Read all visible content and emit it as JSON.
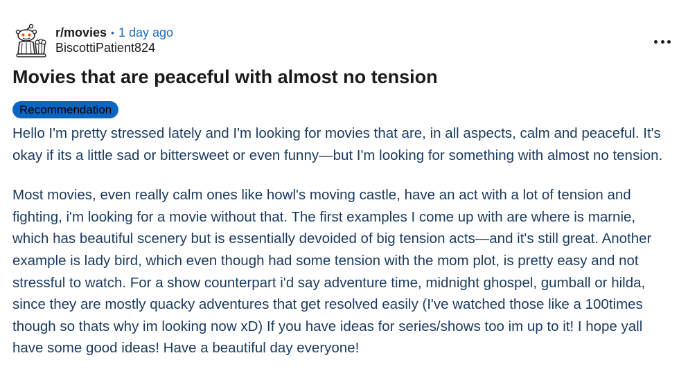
{
  "post": {
    "subreddit": "r/movies",
    "separator": "•",
    "time_ago": "1 day ago",
    "username": "BiscottiPatient824",
    "title": "Movies that are peaceful with almost no tension",
    "flair": "Recommendation",
    "paragraphs": [
      "Hello I'm pretty stressed lately and I'm looking for movies that are, in all aspects, calm and peaceful. It's okay if its a little sad or bittersweet or even funny—but I'm looking for something with almost no tension.",
      "Most movies, even really calm ones like howl's moving castle, have an act with a lot of tension and fighting, i'm looking for a movie without that. The first examples I come up with are where is marnie, which has beautiful scenery but is essentially devoided of big tension acts—and it's still great. Another example is lady bird, which even though had some tension with the mom plot, is pretty easy and not stressful to watch. For a show counterpart i'd say adventure time, midnight ghospel, gumball or hilda, since they are mostly quacky adventures that get resolved easily (I've watched those like a 100times though so thats why im looking now xD) If you have ideas for series/shows too im up to it! I hope yall have some good ideas! Have a beautiful day everyone!"
    ]
  },
  "icons": {
    "avatar": "reddit-snoo-avatar-icon",
    "more": "more-options-icon"
  },
  "colors": {
    "flair_bg": "#0a66c2",
    "meta_blue": "#1e6bb8",
    "body_text": "#1a3a5e"
  }
}
